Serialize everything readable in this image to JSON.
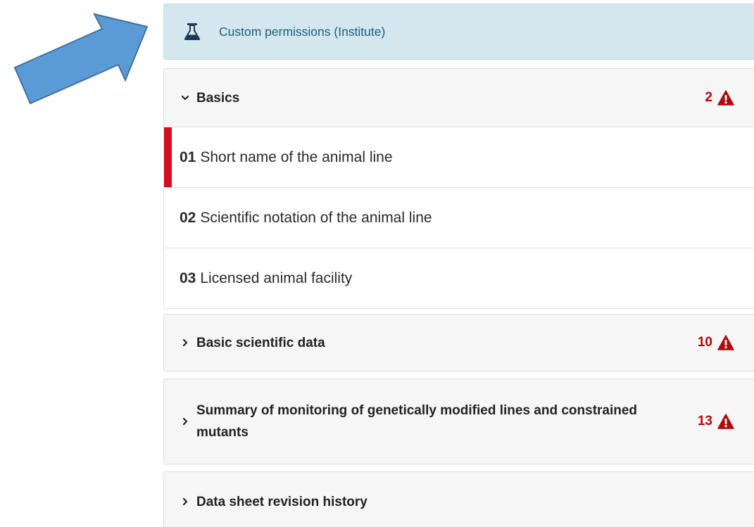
{
  "banner": {
    "label": "Custom permissions (Institute)",
    "icon": "flask-icon"
  },
  "colors": {
    "banner_bg": "#d4e7ef",
    "banner_text": "#1c5d7f",
    "warning_red": "#b00a0a",
    "active_marker": "#d90d1f",
    "arrow_fill": "#5b9bd5"
  },
  "sections": [
    {
      "title": "Basics",
      "expanded": true,
      "count": "2",
      "warning_icon": "warning-triangle-icon",
      "items": [
        {
          "number": "01",
          "label": "Short name of the animal line",
          "active": true
        },
        {
          "number": "02",
          "label": "Scientific notation of the animal line",
          "active": false
        },
        {
          "number": "03",
          "label": "Licensed animal facility",
          "active": false
        }
      ]
    },
    {
      "title": "Basic scientific data",
      "expanded": false,
      "count": "10",
      "warning_icon": "warning-triangle-icon"
    },
    {
      "title": "Summary of monitoring of genetically modified lines and constrained mutants",
      "expanded": false,
      "count": "13",
      "warning_icon": "warning-triangle-icon"
    },
    {
      "title": "Data sheet revision history",
      "expanded": false
    }
  ]
}
